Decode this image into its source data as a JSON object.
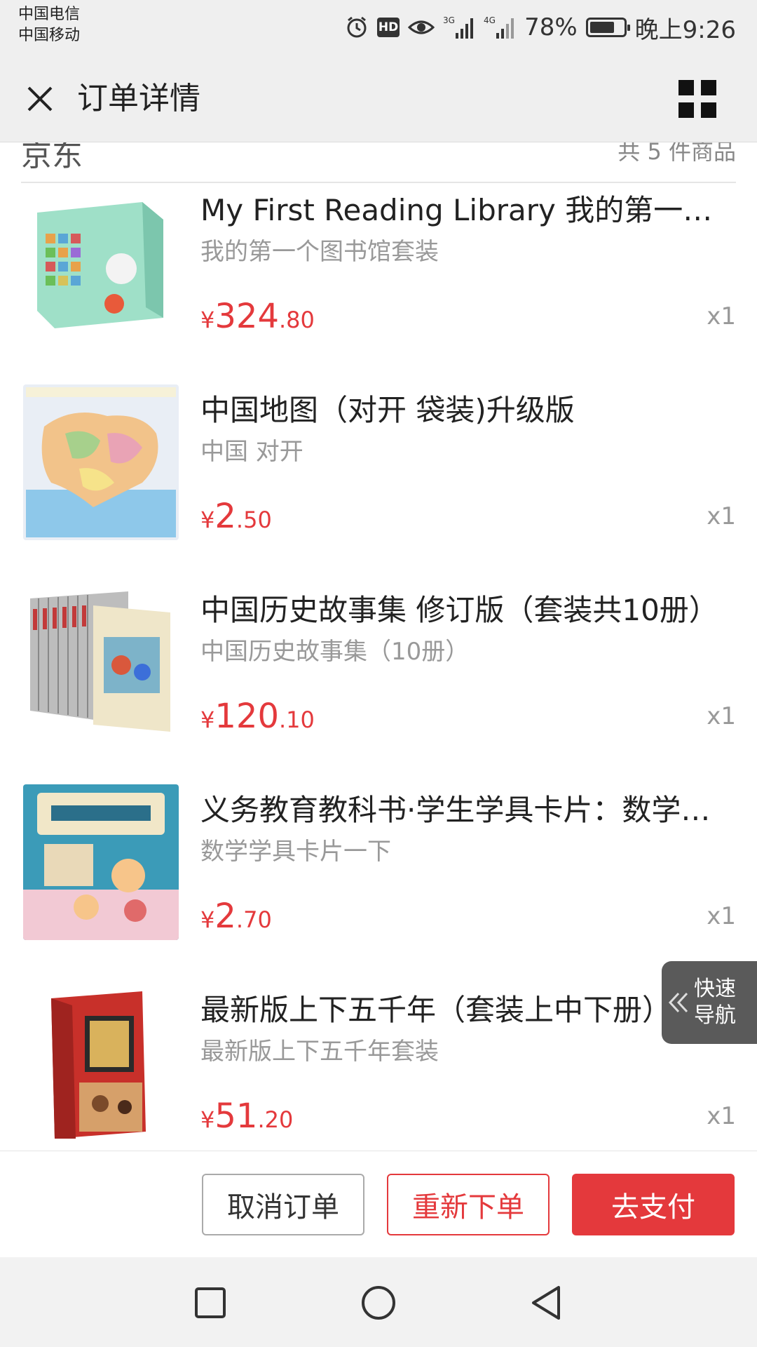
{
  "status_bar": {
    "carrier1": "中国电信",
    "carrier2": "中国移动",
    "network1": "3G",
    "network2": "4G",
    "battery": "78%",
    "battery_level": 0.78,
    "time": "晚上9:26"
  },
  "header": {
    "title": "订单详情",
    "close_icon": "close-icon",
    "menu_icon": "grid-menu-icon"
  },
  "shop": {
    "name": "京东",
    "item_count": "共 5 件商品"
  },
  "items": [
    {
      "name": "My First Reading Library 我的第一个图书馆",
      "spec": "我的第一个图书馆套装",
      "currency": "¥",
      "price_int": "324",
      "price_dec": ".80",
      "qty": "x1",
      "thumb_color": "#9fe0c8"
    },
    {
      "name": "中国地图（对开 袋装)升级版",
      "spec": "中国 对开",
      "currency": "¥",
      "price_int": "2",
      "price_dec": ".50",
      "qty": "x1",
      "thumb_color": "#f3e6c0"
    },
    {
      "name": "中国历史故事集 修订版（套装共10册）",
      "spec": "中国历史故事集（10册）",
      "currency": "¥",
      "price_int": "120",
      "price_dec": ".10",
      "qty": "x1",
      "thumb_color": "#c9c9c9"
    },
    {
      "name": "义务教育教科书·学生学具卡片：数学一年级下册",
      "spec": "数学学具卡片一下",
      "currency": "¥",
      "price_int": "2",
      "price_dec": ".70",
      "qty": "x1",
      "thumb_color": "#3b9bb8"
    },
    {
      "name": "最新版上下五千年（套装上中下册）",
      "spec": "最新版上下五千年套装",
      "currency": "¥",
      "price_int": "51",
      "price_dec": ".20",
      "qty": "x1",
      "thumb_color": "#c8302a"
    }
  ],
  "quick_nav": {
    "line1": "快速",
    "line2": "导航"
  },
  "actions": {
    "cancel": "取消订单",
    "reorder": "重新下单",
    "pay": "去支付"
  },
  "colors": {
    "accent": "#e4393c",
    "bar_bg": "#efefef"
  }
}
